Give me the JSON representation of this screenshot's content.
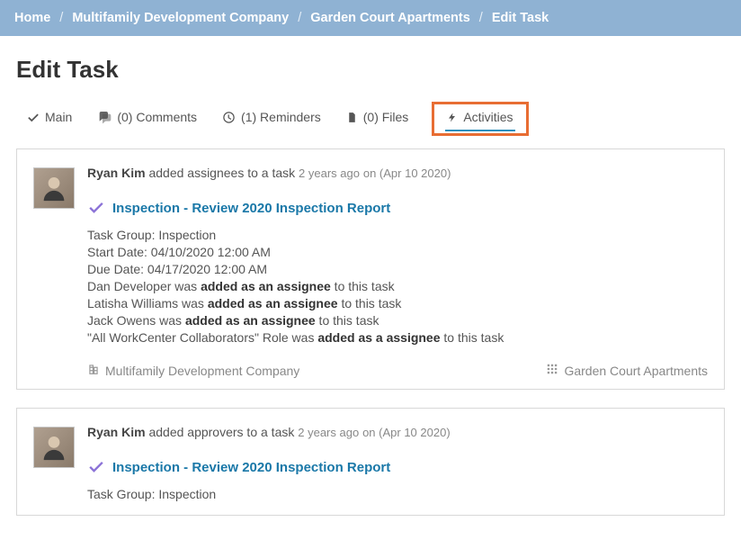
{
  "breadcrumb": {
    "items": [
      {
        "label": "Home"
      },
      {
        "label": "Multifamily Development Company"
      },
      {
        "label": "Garden Court Apartments"
      },
      {
        "label": "Edit Task"
      }
    ]
  },
  "page": {
    "title": "Edit Task"
  },
  "tabs": {
    "main": "Main",
    "comments": "(0) Comments",
    "reminders": "(1) Reminders",
    "files": "(0) Files",
    "activities": "Activities"
  },
  "activities": [
    {
      "actor": "Ryan Kim",
      "verb": "added assignees to a task",
      "rel_time": "2 years ago",
      "abs_time": "on (Apr 10 2020)",
      "task_title": "Inspection - Review 2020 Inspection Report",
      "group_label": "Task Group: Inspection",
      "start_label": "Start Date: 04/10/2020 12:00 AM",
      "due_label": "Due Date: 04/17/2020 12:00 AM",
      "changes": [
        {
          "prefix": "Dan Developer was ",
          "bold": "added as an assignee",
          "suffix": " to this task"
        },
        {
          "prefix": "Latisha Williams was ",
          "bold": "added as an assignee",
          "suffix": " to this task"
        },
        {
          "prefix": "Jack Owens was ",
          "bold": "added as an assignee",
          "suffix": " to this task"
        },
        {
          "prefix": "\"All WorkCenter Collaborators\" Role was ",
          "bold": "added as a assignee",
          "suffix": " to this task"
        }
      ],
      "footer_company": "Multifamily Development Company",
      "footer_project": "Garden Court Apartments"
    },
    {
      "actor": "Ryan Kim",
      "verb": "added approvers to a task",
      "rel_time": "2 years ago",
      "abs_time": "on (Apr 10 2020)",
      "task_title": "Inspection - Review 2020 Inspection Report",
      "group_label": "Task Group: Inspection"
    }
  ]
}
